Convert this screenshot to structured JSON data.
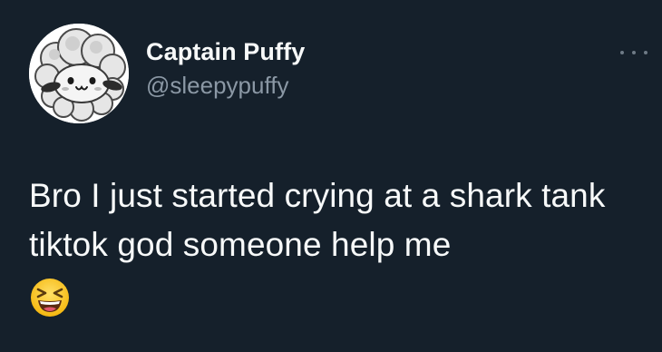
{
  "author": {
    "display_name": "Captain Puffy",
    "handle": "@sleepypuffy",
    "avatar_icon": "sleepy-sheep-avatar"
  },
  "menu": {
    "icon": "more-options-icon"
  },
  "tweet": {
    "text": "Bro I just started crying at a shark tank tiktok god someone help me",
    "emoji": "grinning-squinting-face"
  },
  "colors": {
    "background": "#15202b",
    "primary_text": "#f7f9f9",
    "secondary_text": "#8b98a5"
  }
}
